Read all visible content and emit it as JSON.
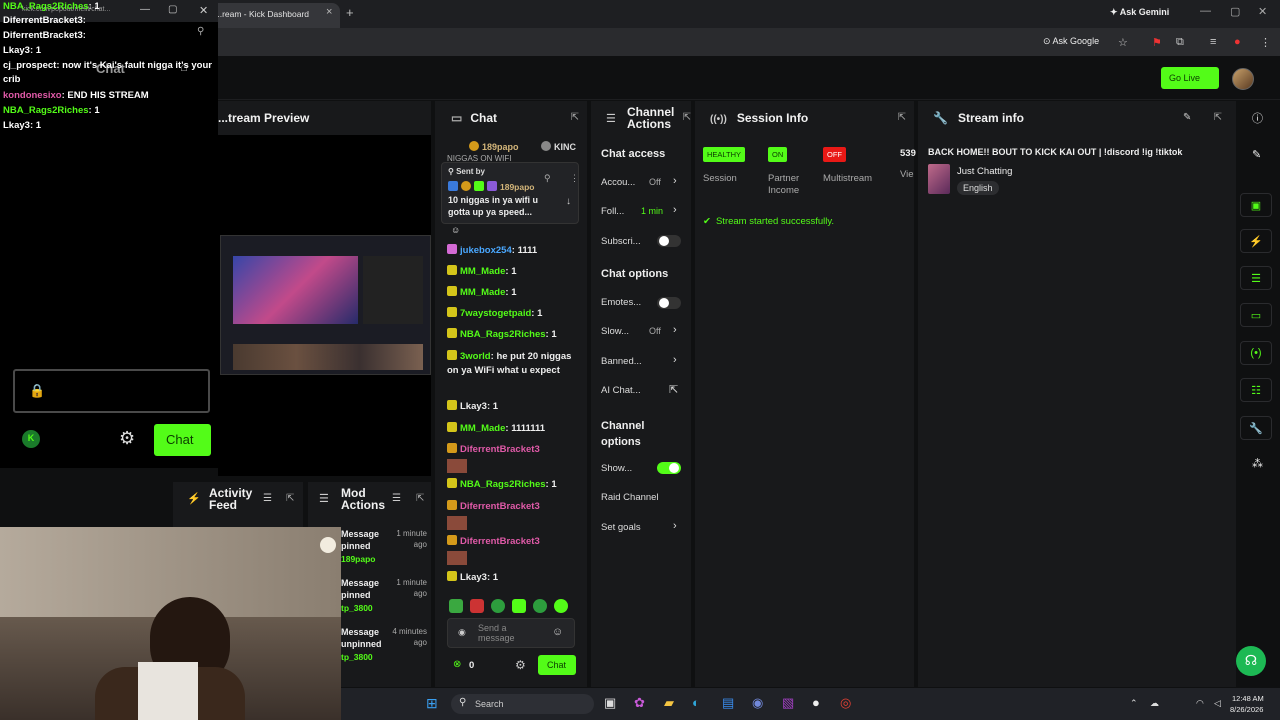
{
  "browser": {
    "tab_title": "...ream - Kick Dashboard",
    "ask_gemini": "Ask Gemini",
    "ask_google": "Ask Google"
  },
  "header": {
    "go_live": "Go Live"
  },
  "stream_preview": {
    "title": "...tream Preview"
  },
  "chat_panel": {
    "title": "Chat",
    "top_users": [
      "189papo",
      "KINC"
    ],
    "pinned_by": "Sent by",
    "pinned_user": "189papo",
    "pinned_message": "10 niggas in ya wifi u gotta up ya speed...",
    "cut_top": "NIGGAS ON WIFI",
    "messages": [
      {
        "user": "jukebox254",
        "text": "1111",
        "color": "#4aa8ff"
      },
      {
        "user": "MM_Made",
        "text": "1",
        "color": "#53fc18"
      },
      {
        "user": "MM_Made",
        "text": "1",
        "color": "#53fc18"
      },
      {
        "user": "7waystogetpaid",
        "text": "1",
        "color": "#53fc18"
      },
      {
        "user": "NBA_Rags2Riches",
        "text": "1",
        "color": "#53fc18"
      },
      {
        "user": "3world",
        "text": "he put 20 niggas on ya WiFi what u expect",
        "color": "#53fc18"
      },
      {
        "user": "Lkay3",
        "text": "1",
        "color": "#eeeeee"
      },
      {
        "user": "MM_Made",
        "text": "1111111",
        "color": "#53fc18"
      },
      {
        "user": "DiferrentBracket3",
        "text": "",
        "color": "#e05aa8"
      },
      {
        "user": "NBA_Rags2Riches",
        "text": "1",
        "color": "#53fc18"
      },
      {
        "user": "DiferrentBracket3",
        "text": "",
        "color": "#e05aa8"
      },
      {
        "user": "DiferrentBracket3",
        "text": "",
        "color": "#e05aa8"
      },
      {
        "user": "Lkay3",
        "text": "1",
        "color": "#eeeeee"
      }
    ],
    "send_placeholder": "Send a message",
    "count": "0",
    "chat_button": "Chat"
  },
  "channel_actions": {
    "title": "Channel Actions",
    "chat_access": "Chat access",
    "account_age": "Accou...",
    "account_age_val": "Off",
    "followers": "Foll...",
    "followers_val": "1 min",
    "subscribers": "Subscri...",
    "chat_options": "Chat options",
    "emotes": "Emotes...",
    "slow": "Slow...",
    "slow_val": "Off",
    "banned": "Banned...",
    "ai_chat": "AI Chat...",
    "channel_options": "Channel options",
    "show": "Show...",
    "raid": "Raid Channel",
    "goals": "Set goals"
  },
  "session_info": {
    "title": "Session Info",
    "healthy": "HEALTHY",
    "session": "Session",
    "on": "ON",
    "partner_income": "Partner Income",
    "off": "OFF",
    "multistream": "Multistream",
    "viewers_num": "539",
    "viewers_label": "Vie",
    "started": "Stream started successfully."
  },
  "stream_info": {
    "title": "Stream info",
    "stream_title": "BACK HOME!! BOUT TO KICK KAI OUT | !discord !ig !tiktok",
    "category": "Just Chatting",
    "language": "English"
  },
  "activity": {
    "activity_feed": "Activity Feed",
    "mod_actions": "Mod Actions",
    "items": [
      {
        "action": "Message pinned",
        "time": "1 minute ago",
        "user": "189papo"
      },
      {
        "action": "Message pinned",
        "time": "1 minute ago",
        "user": "tp_3800"
      },
      {
        "action": "Message unpinned",
        "time": "4 minutes ago",
        "user": "tp_3800"
      }
    ]
  },
  "overlay_chat": {
    "url": "kick.com/popout/mellt/chat...",
    "title": "Chat",
    "lines": [
      {
        "user": "NBA_Rags2Riches",
        "text": "1",
        "color": "#53fc18"
      },
      {
        "user": "DiferrentBracket3",
        "text": "",
        "color": "#ffffff"
      },
      {
        "user": "DiferrentBracket3",
        "text": "",
        "color": "#ffffff"
      },
      {
        "user": "Lkay3",
        "text": "1",
        "color": "#ffffff"
      },
      {
        "user": "cj_prospect",
        "text": "now it's Kai's fault nigga it's your crib",
        "color": "#ffffff"
      },
      {
        "user": "kondonesixo",
        "text": "END HIS STREAM",
        "color": "#e05aa8"
      },
      {
        "user": "NBA_Rags2Riches",
        "text": "1",
        "color": "#53fc18"
      },
      {
        "user": "Lkay3",
        "text": "1",
        "color": "#ffffff"
      }
    ],
    "chat_button": "Chat"
  },
  "taskbar": {
    "search": "Search",
    "time": "12:48 AM",
    "date": "8/26/2026"
  }
}
